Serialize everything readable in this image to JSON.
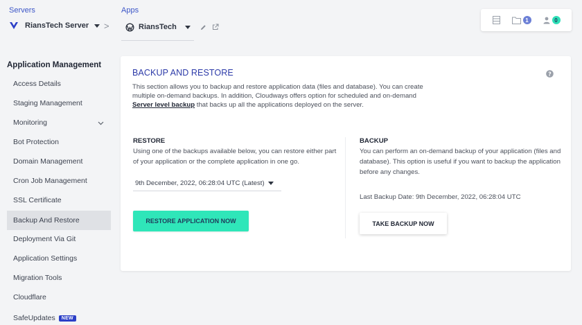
{
  "header": {
    "servers": {
      "label": "Servers",
      "name": "RiansTech Server"
    },
    "apps": {
      "label": "Apps",
      "name": "RiansTech"
    },
    "separator": ">",
    "actions": {
      "notifications_count": "1",
      "users_count": "0"
    }
  },
  "sidebar": {
    "heading": "Application Management",
    "items": [
      {
        "label": "Access Details"
      },
      {
        "label": "Staging Management"
      },
      {
        "label": "Monitoring"
      },
      {
        "label": "Bot Protection"
      },
      {
        "label": "Domain Management"
      },
      {
        "label": "Cron Job Management"
      },
      {
        "label": "SSL Certificate"
      },
      {
        "label": "Backup And Restore"
      },
      {
        "label": "Deployment Via Git"
      },
      {
        "label": "Application Settings"
      },
      {
        "label": "Migration Tools"
      },
      {
        "label": "Cloudflare"
      },
      {
        "label": "SafeUpdates",
        "badge": "NEW"
      }
    ]
  },
  "main": {
    "title": "BACKUP AND RESTORE",
    "description_part1": "This section allows you to backup and restore application data (files and database). You can create multiple on-demand backups. In addition, Cloudways offers option for scheduled and on-demand ",
    "description_link": "Server level backup",
    "description_part2": " that backs up all the applications deployed on the server.",
    "restore": {
      "title": "RESTORE",
      "text": "Using one of the backups available below, you can restore either part of your application or the complete application in one go.",
      "selected_backup": "9th December, 2022, 06:28:04 UTC (Latest)",
      "button": "RESTORE APPLICATION NOW"
    },
    "backup": {
      "title": "BACKUP",
      "text": "You can perform an on-demand backup of your application (files and database). This option is useful if you want to backup the application before any changes.",
      "last_backup": "Last Backup Date: 9th December, 2022, 06:28:04 UTC",
      "button": "TAKE BACKUP NOW"
    }
  },
  "colors": {
    "accent_blue": "#2c3aa8",
    "link_blue": "#3b55c7",
    "primary_button": "#2fe6b9",
    "active_item_bg": "#dfe1e5",
    "new_badge": "#2b3fc7"
  },
  "icons": {
    "server": "cloudways-logo-icon",
    "app": "wordpress-icon",
    "edit": "pencil-icon",
    "open": "external-link-icon",
    "list": "list-icon",
    "folder": "folder-icon",
    "users": "users-icon",
    "help": "help-icon",
    "chevron": "chevron-down-icon"
  }
}
